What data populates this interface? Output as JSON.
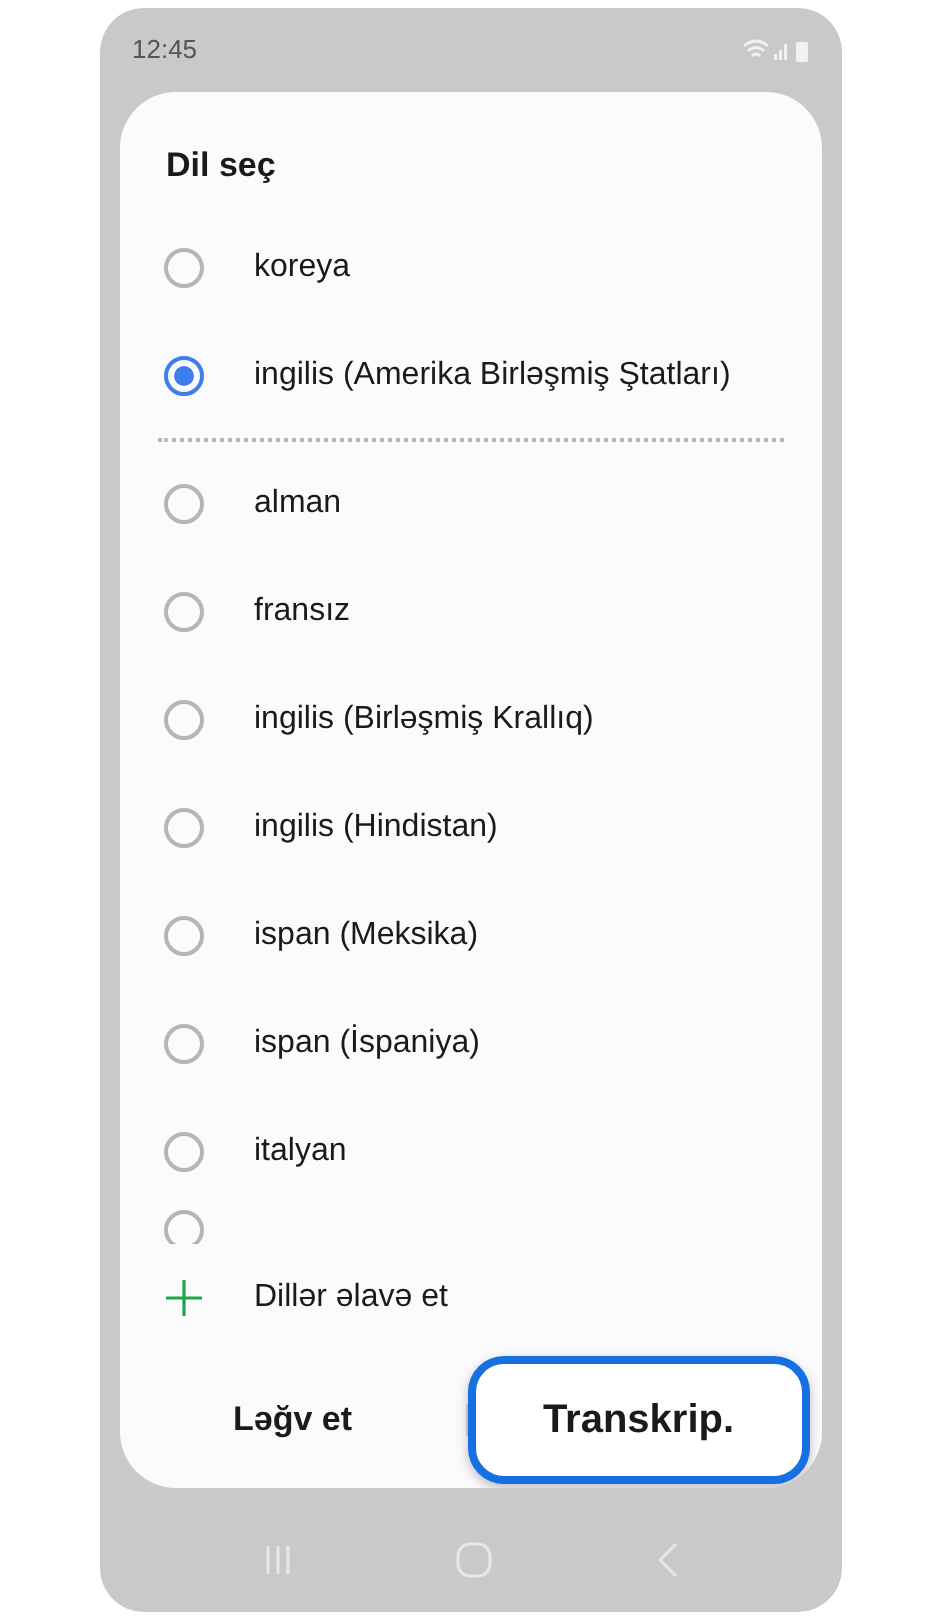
{
  "status_bar": {
    "time": "12:45"
  },
  "dialog": {
    "title": "Dil seç",
    "options": [
      {
        "label": "koreya",
        "selected": false
      },
      {
        "label": "ingilis (Amerika Birləşmiş Ştatları)",
        "selected": true
      },
      {
        "label": "alman",
        "selected": false
      },
      {
        "label": "fransız",
        "selected": false
      },
      {
        "label": "ingilis (Birləşmiş Krallıq)",
        "selected": false
      },
      {
        "label": "ingilis (Hindistan)",
        "selected": false
      },
      {
        "label": "ispan (Meksika)",
        "selected": false
      },
      {
        "label": "ispan (İspaniya)",
        "selected": false
      },
      {
        "label": "italyan",
        "selected": false
      }
    ],
    "partial_option": {
      "selected": false
    },
    "add_languages": "Dillər əlavə et",
    "buttons": [
      {
        "label": "Ləğv et",
        "highlighted": false
      },
      {
        "label": "Transkrip.",
        "highlighted": true
      }
    ]
  }
}
